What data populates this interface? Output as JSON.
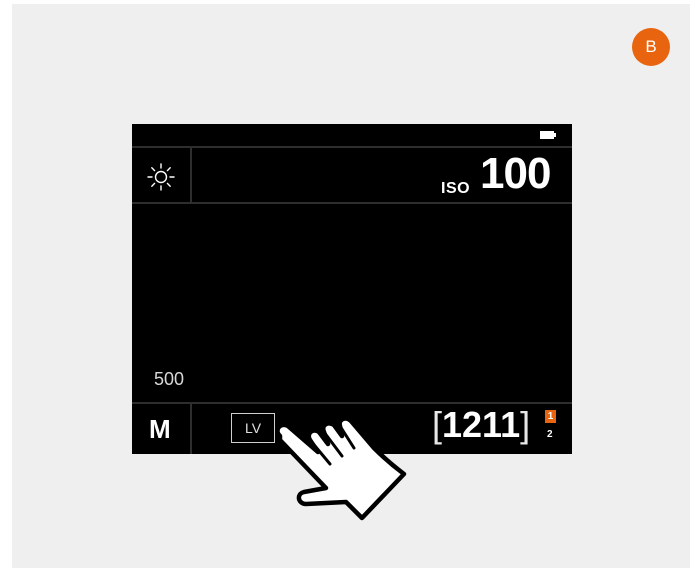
{
  "badge": {
    "label": "B",
    "color": "#e8640e"
  },
  "screen": {
    "battery_icon": "battery-icon",
    "white_balance_icon": "sun-icon",
    "iso_label": "ISO",
    "iso_value": "100",
    "shutter_value": "500",
    "mode": "M",
    "lv_button": "LV",
    "shot_count_open": "[",
    "shot_count": "1211",
    "shot_count_close": "]",
    "card_slot_active": "1",
    "card_slot_other": "2",
    "card_slot_color": "#e8640e"
  },
  "gesture": {
    "icon": "tap-hand-icon"
  }
}
